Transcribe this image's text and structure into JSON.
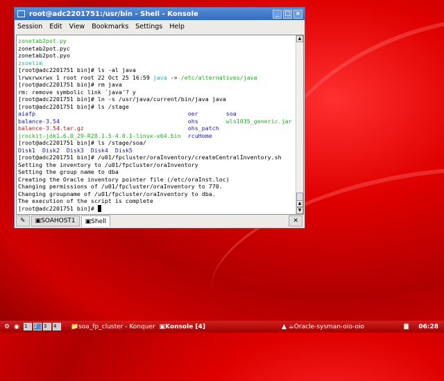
{
  "window": {
    "title": "root@adc2201751:/usr/bin - Shell - Konsole"
  },
  "menu": [
    "Session",
    "Edit",
    "View",
    "Bookmarks",
    "Settings",
    "Help"
  ],
  "colors": {
    "green": "#18b218",
    "cyan": "#18b2b2",
    "blue": "#1818b2",
    "red": "#b21818",
    "black": "#000000"
  },
  "terminal": {
    "lines": [
      [
        {
          "t": "zonetab2pot.py",
          "c": "green"
        }
      ],
      [
        {
          "t": "zonetab2pot.pyc",
          "c": "black"
        }
      ],
      [
        {
          "t": "zonetab2pot.pyo",
          "c": "black"
        }
      ],
      [
        {
          "t": "zsoelim",
          "c": "cyan"
        }
      ],
      [
        {
          "t": "[root@adc2201751 bin]# ls -al java",
          "c": "black"
        }
      ],
      [
        {
          "t": "lrwxrwxrwx 1 root root 22 Oct 25 16:59 ",
          "c": "black"
        },
        {
          "t": "java",
          "c": "cyan"
        },
        {
          "t": " -> ",
          "c": "black"
        },
        {
          "t": "/etc/alternatives/java",
          "c": "green"
        }
      ],
      [
        {
          "t": "[root@adc2201751 bin]# rm java",
          "c": "black"
        }
      ],
      [
        {
          "t": "rm: remove symbolic link `java'? y",
          "c": "black"
        }
      ],
      [
        {
          "t": "[root@adc2201751 bin]# ln -s /usr/java/current/bin/java java",
          "c": "black"
        }
      ],
      [
        {
          "t": "[root@adc2201751 bin]# ls /stage",
          "c": "black"
        }
      ],
      [
        {
          "t": "aiafp                                            ",
          "c": "blue"
        },
        {
          "t": "oer        ",
          "c": "blue"
        },
        {
          "t": "soa",
          "c": "blue"
        }
      ],
      [
        {
          "t": "balance-3.54                                     ",
          "c": "blue"
        },
        {
          "t": "ohs        ",
          "c": "blue"
        },
        {
          "t": "wls1035_generic.jar",
          "c": "green"
        }
      ],
      [
        {
          "t": "balance-3.54.tar.gz                              ",
          "c": "red"
        },
        {
          "t": "ohs_patch",
          "c": "blue"
        }
      ],
      [
        {
          "t": "jrockit-jdk1.6.0_29-R28.1.5-4.0.1-linux-x64.bin  ",
          "c": "green"
        },
        {
          "t": "rcuHome",
          "c": "blue"
        }
      ],
      [
        {
          "t": "[root@adc2201751 bin]# ls /stage/soa/",
          "c": "black"
        }
      ],
      [
        {
          "t": "Disk1  Disk2  Disk3  Disk4  Disk5",
          "c": "blue"
        }
      ],
      [
        {
          "t": "[root@adc2201751 bin]# /u01/fpcluster/oraInventory/createCentralInventory.sh",
          "c": "black"
        }
      ],
      [
        {
          "t": "Setting the inventory to /u01/fpcluster/oraInventory",
          "c": "black"
        }
      ],
      [
        {
          "t": "Setting the group name to dba",
          "c": "black"
        }
      ],
      [
        {
          "t": "Creating the Oracle inventory pointer file (/etc/oraInst.loc)",
          "c": "black"
        }
      ],
      [
        {
          "t": "Changing permissions of /u01/fpcluster/oraInventory to 770.",
          "c": "black"
        }
      ],
      [
        {
          "t": "Changing groupname of /u01/fpcluster/oraInventory to dba.",
          "c": "black"
        }
      ],
      [
        {
          "t": "The execution of the script is complete",
          "c": "black"
        }
      ],
      [
        {
          "t": "[root@adc2201751 bin]# ",
          "c": "black"
        }
      ]
    ]
  },
  "tabs": [
    "SOAHOST1",
    "Shell"
  ],
  "taskbar": {
    "desktops": [
      "1",
      "2",
      "3",
      "4"
    ],
    "tasks": [
      "soa_fp_cluster - Konquer",
      "Konsole [4]",
      "Oracle-sysman-oio-oio"
    ],
    "clock": "06:28"
  }
}
